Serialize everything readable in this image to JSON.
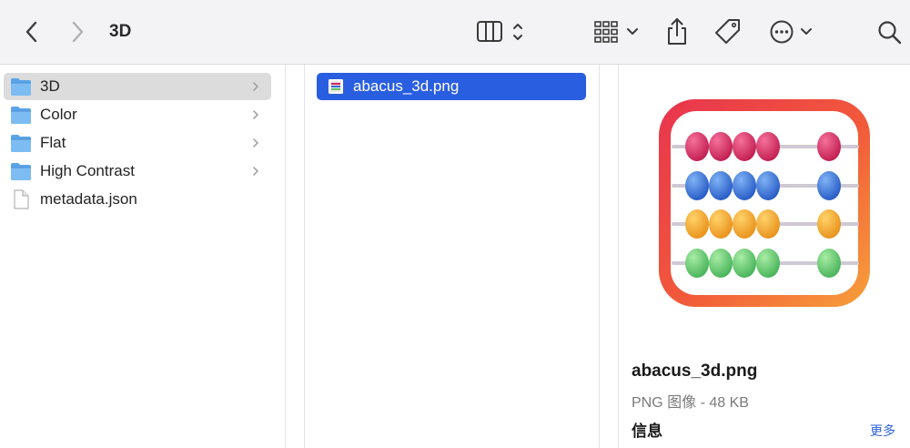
{
  "window": {
    "title": "3D"
  },
  "toolbar": {
    "icons": [
      "chevron-left-icon",
      "chevron-right-icon",
      "column-view-icon",
      "group-icon",
      "share-icon",
      "tag-icon",
      "more-icon",
      "search-icon"
    ]
  },
  "sidebar_column": {
    "items": [
      {
        "label": "3D",
        "type": "folder",
        "selected": true
      },
      {
        "label": "Color",
        "type": "folder",
        "selected": false
      },
      {
        "label": "Flat",
        "type": "folder",
        "selected": false
      },
      {
        "label": "High Contrast",
        "type": "folder",
        "selected": false
      },
      {
        "label": "metadata.json",
        "type": "file",
        "selected": false
      }
    ]
  },
  "files_column": {
    "items": [
      {
        "label": "abacus_3d.png",
        "type": "image",
        "selected": true
      }
    ]
  },
  "preview": {
    "name": "abacus_3d.png",
    "kind": "PNG 图像 - 48 KB",
    "info_label": "信息",
    "more_link": "更多"
  },
  "colors": {
    "accent": "#2a5ee0",
    "folder": "#5aa5e8",
    "row_red": "#d0245a",
    "row_blue": "#2f6fd4",
    "row_orange": "#f0a21e",
    "row_green": "#5cc86a"
  }
}
